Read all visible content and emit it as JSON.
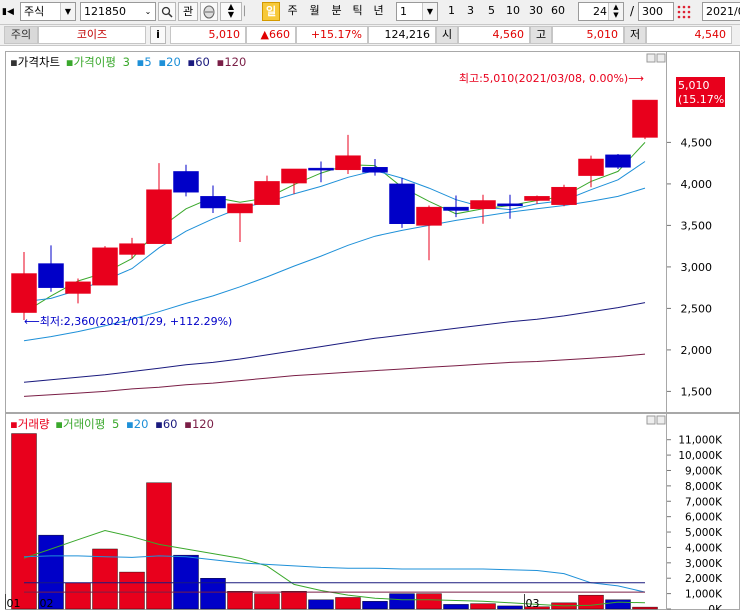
{
  "toolbar": {
    "market": "주식",
    "code": "121850",
    "btn_gwan": "관",
    "periods": [
      {
        "label": "일",
        "selected": true
      },
      {
        "label": "주",
        "selected": false
      },
      {
        "label": "월",
        "selected": false
      },
      {
        "label": "분",
        "selected": false
      },
      {
        "label": "틱",
        "selected": false
      },
      {
        "label": "년",
        "selected": false
      }
    ],
    "interval_value": "1",
    "intervals": [
      "1",
      "3",
      "5",
      "10",
      "30",
      "60"
    ],
    "count_value": "24",
    "slash": "/",
    "total_value": "300",
    "date_value": "2021/0"
  },
  "info": {
    "warn": "주의",
    "name": "코이즈",
    "i_button": "i",
    "price": "5,010",
    "change": "▲660",
    "rate": "+15.17%",
    "volume": "124,216",
    "open_label": "시",
    "open": "4,560",
    "high_label": "고",
    "high": "5,010",
    "low_label": "저",
    "low": "4,540"
  },
  "colors": {
    "up": "#e8001c",
    "down": "#0000c8",
    "ma5": "#3aa82c",
    "ma20": "#1e90d8",
    "ma60": "#1a1a7e",
    "ma120": "#7a1e46"
  },
  "chart_data": {
    "type": "candlestick",
    "price_legend": {
      "title": "가격차트",
      "ma_label": "가격이평",
      "periods": [
        {
          "text": "3",
          "color": "#3aa82c"
        },
        {
          "text": "5",
          "color": "#1e90d8"
        },
        {
          "text": "20",
          "color": "#1e90d8"
        },
        {
          "text": "60",
          "color": "#1a1a7e"
        },
        {
          "text": "120",
          "color": "#7a1e46"
        }
      ]
    },
    "volume_legend": {
      "title": "거래량",
      "ma_label": "거래이평",
      "periods": [
        {
          "text": "5",
          "color": "#3aa82c"
        },
        {
          "text": "20",
          "color": "#1e90d8"
        },
        {
          "text": "60",
          "color": "#1a1a7e"
        },
        {
          "text": "120",
          "color": "#7a1e46"
        }
      ]
    },
    "price_axis": {
      "min": 1300,
      "max": 5300,
      "ticks": [
        "1,500",
        "2,000",
        "2,500",
        "3,000",
        "3,500",
        "4,000",
        "4,500"
      ],
      "tick_values": [
        1500,
        2000,
        2500,
        3000,
        3500,
        4000,
        4500
      ]
    },
    "volume_axis": {
      "max": 11500000,
      "ticks": [
        "11,000K",
        "10,000K",
        "9,000K",
        "8,000K",
        "7,000K",
        "6,000K",
        "5,000K",
        "4,000K",
        "3,000K",
        "2,000K",
        "1,000K",
        "0K"
      ],
      "tick_values": [
        11000000,
        10000000,
        9000000,
        8000000,
        7000000,
        6000000,
        5000000,
        4000000,
        3000000,
        2000000,
        1000000,
        0
      ]
    },
    "x_labels": [
      {
        "index": 0,
        "text": "01"
      },
      {
        "index": 1,
        "text": "02"
      },
      {
        "index": 19,
        "text": "03"
      }
    ],
    "candles": [
      {
        "o": 2450,
        "h": 3180,
        "l": 2360,
        "c": 2920,
        "v": 11400000
      },
      {
        "o": 3040,
        "h": 3260,
        "l": 2700,
        "c": 2750,
        "v": 4800000
      },
      {
        "o": 2680,
        "h": 2860,
        "l": 2560,
        "c": 2820,
        "v": 1700000
      },
      {
        "o": 2780,
        "h": 3250,
        "l": 2780,
        "c": 3230,
        "v": 3900000
      },
      {
        "o": 3150,
        "h": 3350,
        "l": 3100,
        "c": 3280,
        "v": 2400000
      },
      {
        "o": 3280,
        "h": 4250,
        "l": 3280,
        "c": 3930,
        "v": 8200000
      },
      {
        "o": 4150,
        "h": 4230,
        "l": 3850,
        "c": 3900,
        "v": 3500000
      },
      {
        "o": 3850,
        "h": 3980,
        "l": 3650,
        "c": 3710,
        "v": 2000000
      },
      {
        "o": 3650,
        "h": 3760,
        "l": 3300,
        "c": 3760,
        "v": 1150000
      },
      {
        "o": 3750,
        "h": 4100,
        "l": 3750,
        "c": 4030,
        "v": 1000000
      },
      {
        "o": 4010,
        "h": 4160,
        "l": 3880,
        "c": 4180,
        "v": 1150000
      },
      {
        "o": 4190,
        "h": 4270,
        "l": 4020,
        "c": 4170,
        "v": 600000
      },
      {
        "o": 4170,
        "h": 4590,
        "l": 4120,
        "c": 4340,
        "v": 750000
      },
      {
        "o": 4200,
        "h": 4300,
        "l": 4100,
        "c": 4140,
        "v": 500000
      },
      {
        "o": 4000,
        "h": 4070,
        "l": 3470,
        "c": 3520,
        "v": 1000000
      },
      {
        "o": 3500,
        "h": 3740,
        "l": 3080,
        "c": 3720,
        "v": 1000000
      },
      {
        "o": 3720,
        "h": 3860,
        "l": 3600,
        "c": 3680,
        "v": 300000
      },
      {
        "o": 3700,
        "h": 3870,
        "l": 3520,
        "c": 3800,
        "v": 350000
      },
      {
        "o": 3760,
        "h": 3870,
        "l": 3580,
        "c": 3750,
        "v": 200000
      },
      {
        "o": 3800,
        "h": 3860,
        "l": 3760,
        "c": 3850,
        "v": 150000
      },
      {
        "o": 3750,
        "h": 3990,
        "l": 3730,
        "c": 3960,
        "v": 400000
      },
      {
        "o": 4100,
        "h": 4340,
        "l": 3960,
        "c": 4300,
        "v": 900000
      },
      {
        "o": 4350,
        "h": 4360,
        "l": 4180,
        "c": 4200,
        "v": 600000
      },
      {
        "o": 4560,
        "h": 5010,
        "l": 4540,
        "c": 5010,
        "v": 124216
      }
    ],
    "ma_price": [
      {
        "period": 3,
        "color": "#3aa82c",
        "values": [
          2450,
          2650,
          2830,
          2930,
          3100,
          3460,
          3700,
          3840,
          3780,
          3830,
          3990,
          4130,
          4230,
          4220,
          3960,
          3790,
          3640,
          3700,
          3740,
          3800,
          3850,
          4030,
          4150,
          4500
        ]
      },
      {
        "period": 5,
        "color": "#1e90d8",
        "values": [
          2580,
          2620,
          2720,
          2840,
          2980,
          3230,
          3430,
          3580,
          3710,
          3780,
          3880,
          3970,
          4080,
          4160,
          4070,
          3950,
          3810,
          3720,
          3690,
          3760,
          3800,
          3930,
          4050,
          4270
        ]
      },
      {
        "period": 20,
        "color": "#1e90d8",
        "values": [
          2110,
          2160,
          2220,
          2290,
          2370,
          2460,
          2560,
          2650,
          2760,
          2880,
          3010,
          3130,
          3260,
          3370,
          3440,
          3500,
          3560,
          3610,
          3660,
          3700,
          3740,
          3790,
          3850,
          3950
        ]
      },
      {
        "period": 60,
        "color": "#1a1a7e",
        "values": [
          1610,
          1640,
          1670,
          1700,
          1740,
          1780,
          1820,
          1850,
          1890,
          1940,
          1990,
          2040,
          2090,
          2140,
          2180,
          2220,
          2260,
          2300,
          2340,
          2370,
          2410,
          2460,
          2510,
          2570
        ]
      },
      {
        "period": 120,
        "color": "#7a1e46",
        "values": [
          1440,
          1460,
          1480,
          1500,
          1530,
          1550,
          1580,
          1600,
          1630,
          1660,
          1690,
          1710,
          1730,
          1750,
          1770,
          1790,
          1810,
          1830,
          1850,
          1860,
          1880,
          1900,
          1920,
          1950
        ]
      }
    ],
    "ma_volume": [
      {
        "period": 5,
        "color": "#3aa82c",
        "values": [
          3300000,
          3900000,
          4500000,
          5100000,
          4700000,
          4200000,
          3900000,
          3600000,
          3300000,
          2800000,
          1600000,
          1200000,
          900000,
          700000,
          600000,
          600000,
          550000,
          500000,
          400000,
          300000,
          200000,
          250000,
          450000,
          400000
        ]
      },
      {
        "period": 20,
        "color": "#1e90d8",
        "values": [
          3400000,
          3450000,
          3450000,
          3400000,
          3350000,
          3450000,
          3400000,
          3200000,
          3000000,
          2900000,
          2800000,
          2700000,
          2650000,
          2650000,
          2600000,
          2600000,
          2600000,
          2600000,
          2550000,
          2500000,
          2300000,
          1700000,
          1500000,
          1100000
        ]
      },
      {
        "period": 60,
        "color": "#1a1a7e",
        "values": [
          1700000,
          1700000,
          1700000,
          1700000,
          1700000,
          1700000,
          1700000,
          1700000,
          1700000,
          1700000,
          1700000,
          1700000,
          1700000,
          1700000,
          1700000,
          1700000,
          1700000,
          1700000,
          1700000,
          1700000,
          1700000,
          1700000,
          1700000,
          1700000
        ]
      },
      {
        "period": 120,
        "color": "#7a1e46",
        "values": [
          1100000,
          1100000,
          1100000,
          1100000,
          1100000,
          1100000,
          1100000,
          1100000,
          1100000,
          1100000,
          1100000,
          1100000,
          1100000,
          1100000,
          1100000,
          1100000,
          1100000,
          1100000,
          1100000,
          1100000,
          1100000,
          1100000,
          1100000,
          1100000
        ]
      }
    ],
    "annotations": {
      "high": "최고:5,010(2021/03/08, 0.00%)⟶",
      "low": "⟵최저:2,360(2021/01/29, +112.29%)"
    },
    "current_price_label": "5,010",
    "current_rate_label": "(15.17%)"
  }
}
